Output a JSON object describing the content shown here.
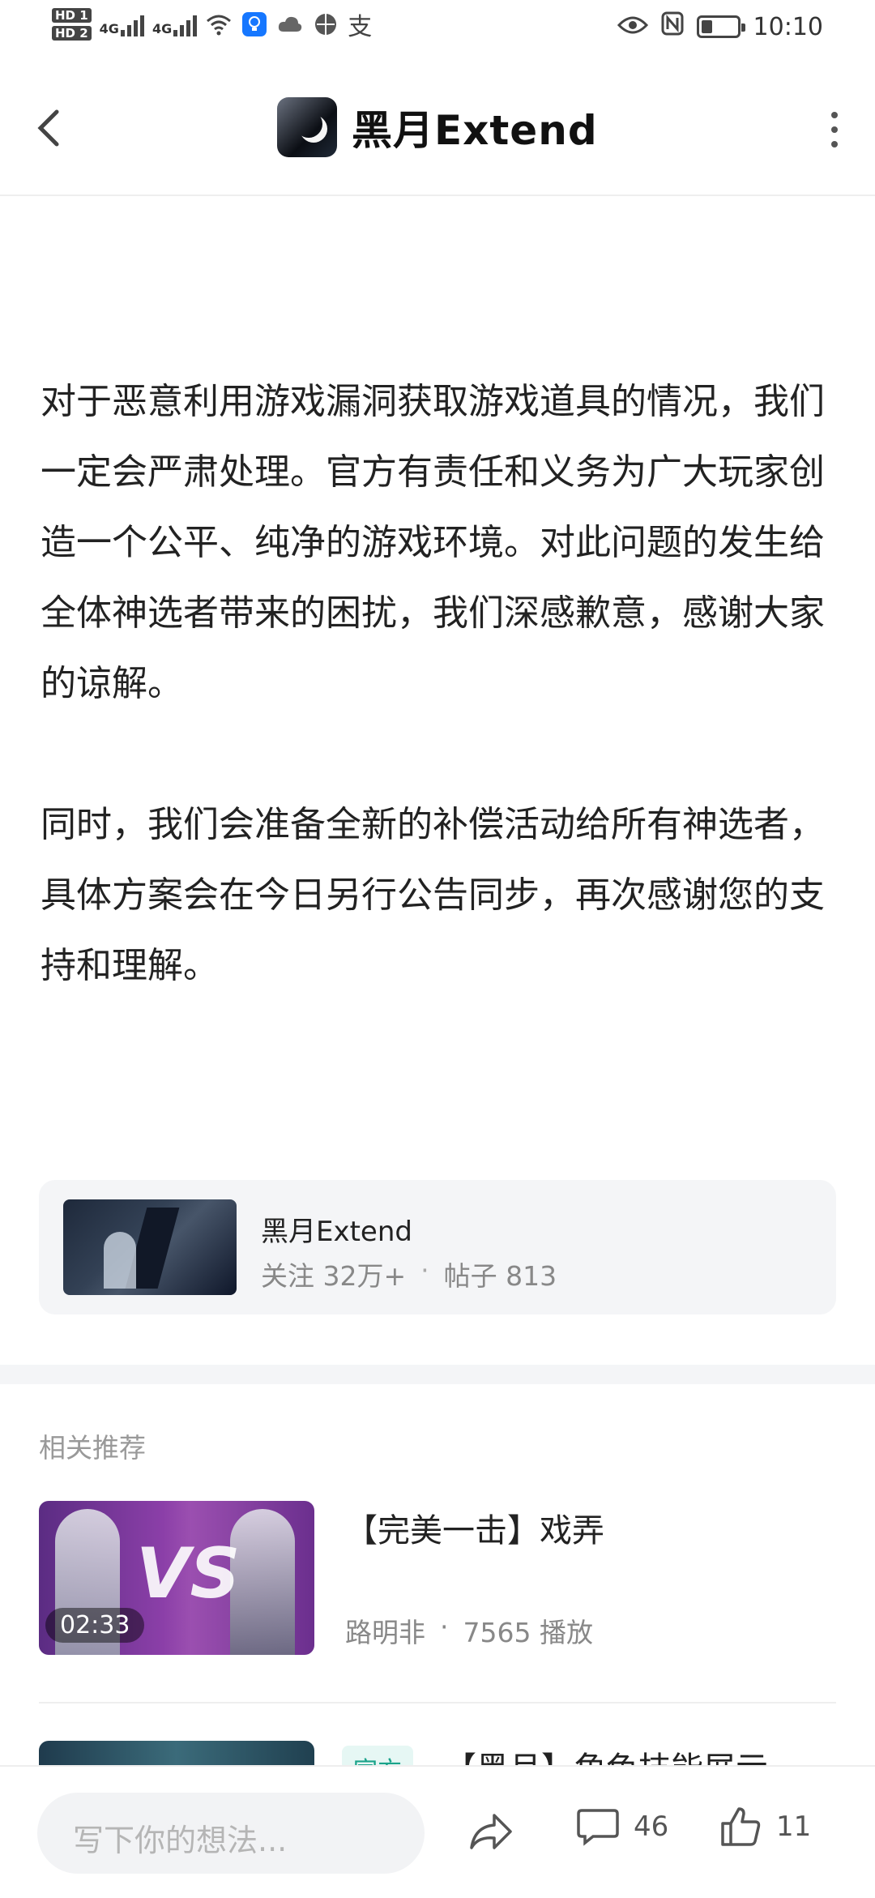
{
  "status_bar": {
    "hd1": "HD 1",
    "hd2": "HD 2",
    "net1": "4G",
    "net2": "4G",
    "alipay_glyph": "支",
    "time": "10:10",
    "battery_level": 0.3
  },
  "header": {
    "title": "黑月Extend"
  },
  "article": {
    "paragraphs": [
      "对于恶意利用游戏漏洞获取游戏道具的情况，我们一定会严肃处理。官方有责任和义务为广大玩家创造一个公平、纯净的游戏环境。对此问题的发生给全体神选者带来的困扰，我们深感歉意，感谢大家的谅解。",
      "同时，我们会准备全新的补偿活动给所有神选者，具体方案会在今日另行公告同步，再次感谢您的支持和理解。"
    ]
  },
  "forum_card": {
    "name": "黑月Extend",
    "followers": "关注 32万+",
    "dot": "·",
    "posts": "帖子 813"
  },
  "recommendations": {
    "title": "相关推荐",
    "items": [
      {
        "title": "【完美一击】戏弄",
        "duration": "02:33",
        "author": "路明非",
        "dot": "·",
        "plays": "7565 播放"
      },
      {
        "badge": "官方",
        "title": "【黑月】角色技能展示"
      }
    ]
  },
  "bottom_bar": {
    "comment_placeholder": "写下你的想法...",
    "comment_count": "46",
    "like_count": "11"
  }
}
